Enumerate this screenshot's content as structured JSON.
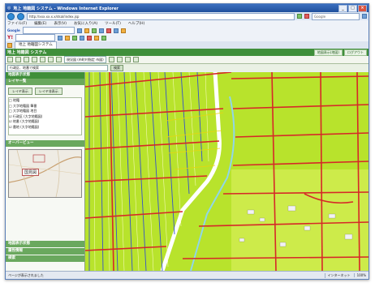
{
  "browser": {
    "title": "地上 地籍図 システム - Windows Internet Explorer",
    "url": "http://xxx.xx.x.x/dsal/index.jsp",
    "search_placeholder": "Google",
    "menu": [
      "ファイル(F)",
      "編集(E)",
      "表示(V)",
      "お気に入り(A)",
      "ツール(T)",
      "ヘルプ(H)"
    ],
    "links_label": "Google",
    "yahoo_label": "Y!",
    "tab_label": "地上 地籍図システム"
  },
  "app": {
    "header_title": "地上 地籍図 システム",
    "header_buttons": [
      "地図表示(地図)",
      "ログアウト"
    ],
    "layer_select": "現況図 (市町村指定 市図)",
    "search_placeholder": "行政区、地番で検索",
    "search_button": "検索",
    "sidebar": {
      "section_main": "地図表示状態",
      "section_layers": "レイヤ一覧",
      "layer_buttons": [
        "レイヤ表示",
        "レイヤ非表示"
      ],
      "tree": [
        "□ 地籍",
        "  □ 大字地籍図 筆番",
        "  □ 大字地籍図 地目",
        "    ☑ 行政区 (大字地籍図)",
        "    ☑ 地番 (大字地籍図)",
        "    ☑ 農地 (大字地籍図)"
      ],
      "section_overview": "オーバービュー",
      "overview_label": "国見図",
      "bottom_sections": [
        "地図表示状態",
        "属性情報",
        "検索"
      ]
    }
  },
  "status": {
    "left": "ページが表示されました",
    "zone": "インターネット",
    "zoom": "100%"
  }
}
